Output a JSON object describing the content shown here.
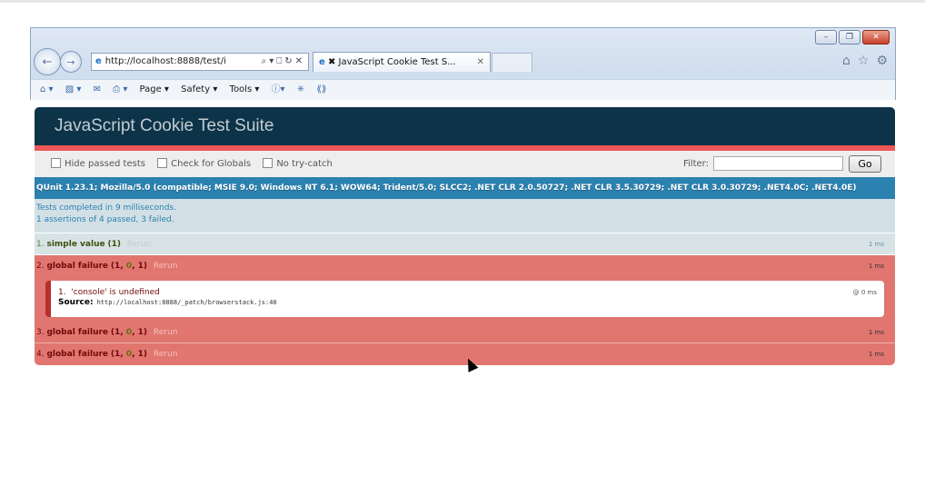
{
  "browser": {
    "address": "http://localhost:8888/test/i",
    "address_host_bold": "localhost",
    "tab_title": "JavaScript Cookie Test S...",
    "window_controls": [
      "–",
      "❐",
      "✕"
    ],
    "command_bar": [
      "Page ▾",
      "Safety ▾",
      "Tools ▾"
    ]
  },
  "qunit": {
    "header": "JavaScript Cookie Test Suite",
    "toolbar": {
      "hide_passed": "Hide passed tests",
      "check_globals": "Check for Globals",
      "no_try_catch": "No try-catch",
      "filter_label": "Filter:",
      "go_label": "Go"
    },
    "useragent": "QUnit 1.23.1; Mozilla/5.0 (compatible; MSIE 9.0; Windows NT 6.1; WOW64; Trident/5.0; SLCC2; .NET CLR 2.0.50727; .NET CLR 3.5.30729; .NET CLR 3.0.30729; .NET4.0C; .NET4.0E)",
    "result_line1": "Tests completed in 9 milliseconds.",
    "result_line2": "1 assertions of 4 passed, 3 failed.",
    "tests": [
      {
        "num": "1.",
        "name": "simple value",
        "counts": "(1)",
        "rerun": "Rerun",
        "time": "1 ms"
      },
      {
        "num": "2.",
        "name": "global failure",
        "c_open": "(1, ",
        "c_pass": "0",
        "c_close": ", 1)",
        "rerun": "Rerun",
        "time": "1 ms",
        "assert_num": "1.",
        "assert_msg": "'console' is undefined",
        "assert_time": "@ 0 ms",
        "source_label": "Source:",
        "source_value": "http://localhost:8888/_patch/browserstack.js:40"
      },
      {
        "num": "3.",
        "name": "global failure",
        "c_open": "(1, ",
        "c_pass": "0",
        "c_close": ", 1)",
        "rerun": "Rerun",
        "time": "1 ms"
      },
      {
        "num": "4.",
        "name": "global failure",
        "c_open": "(1, ",
        "c_pass": "0",
        "c_close": ", 1)",
        "rerun": "Rerun",
        "time": "1 ms"
      }
    ]
  },
  "colors": {
    "header_bg": "#0d3349",
    "banner_fail": "#ee5757",
    "useragent_bg": "#2b81af",
    "test_fail_bg": "#e0766f"
  }
}
